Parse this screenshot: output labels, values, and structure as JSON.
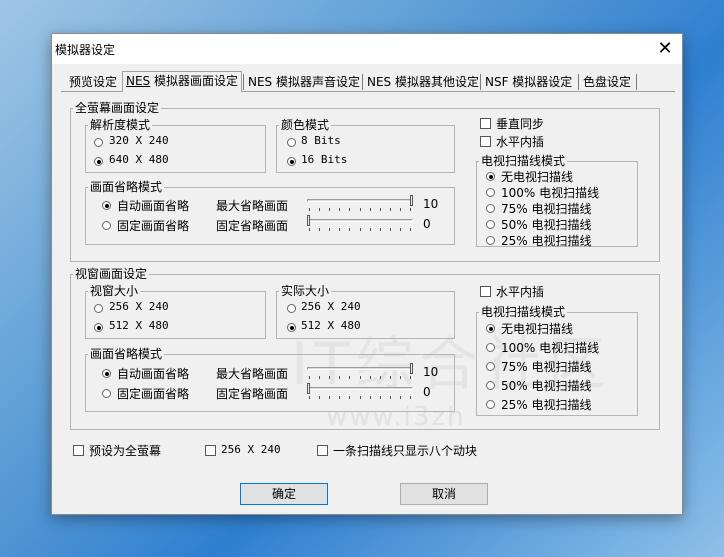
{
  "window": {
    "title": "模拟器设定",
    "close_symbol": "✕"
  },
  "tabs": [
    {
      "label": "预览设定"
    },
    {
      "label_prefix": "NES",
      "label": " 模拟器画面设定"
    },
    {
      "label": "NES 模拟器声音设定"
    },
    {
      "label": "NES 模拟器其他设定"
    },
    {
      "label": "NSF 模拟器设定"
    },
    {
      "label": "色盘设定"
    }
  ],
  "fullscreen": {
    "title": "全萤幕画面设定",
    "resolution": {
      "title": "解析度模式",
      "options": [
        "320 X 240",
        "640 X 480"
      ],
      "selected": 1
    },
    "color": {
      "title": "颜色模式",
      "options": [
        "8 Bits",
        "16 Bits"
      ],
      "selected": 1
    },
    "vsync": "垂直同步",
    "hinterp": "水平内插",
    "scanline": {
      "title": "电视扫描线模式",
      "options": [
        "无电视扫描线",
        "100% 电视扫描线",
        "75% 电视扫描线",
        "50% 电视扫描线",
        "25% 电视扫描线"
      ],
      "selected": 0
    },
    "frameskip": {
      "title": "画面省略模式",
      "auto": "自动画面省略",
      "fixed": "固定画面省略",
      "selected": 0,
      "max_label": "最大省略画面",
      "max_value": "10",
      "fixed_label": "固定省略画面",
      "fixed_value": "0"
    }
  },
  "windowed": {
    "title": "视窗画面设定",
    "window_size": {
      "title": "视窗大小",
      "options": [
        "256 X 240",
        "512 X 480"
      ],
      "selected": 1
    },
    "actual_size": {
      "title": "实际大小",
      "options": [
        "256 X 240",
        "512 X 480"
      ],
      "selected": 1
    },
    "hinterp": "水平内插",
    "scanline": {
      "title": "电视扫描线模式",
      "options": [
        "无电视扫描线",
        "100% 电视扫描线",
        "75% 电视扫描线",
        "50% 电视扫描线",
        "25% 电视扫描线"
      ],
      "selected": 0
    },
    "frameskip": {
      "title": "画面省略模式",
      "auto": "自动画面省略",
      "fixed": "固定画面省略",
      "selected": 0,
      "max_label": "最大省略画面",
      "max_value": "10",
      "fixed_label": "固定省略画面",
      "fixed_value": "0"
    }
  },
  "bottom": {
    "default_fullscreen": "预设为全萤幕",
    "res_256": "256 X 240",
    "eight_sprites": "一条扫描线只显示八个动块"
  },
  "buttons": {
    "ok": "确定",
    "cancel": "取消"
  },
  "watermark": {
    "main": "IT综合社区",
    "url": "www.i3zh"
  },
  "colors": {
    "dialog_bg": "#f0f0f0",
    "default_button_border": "#0078d7"
  }
}
